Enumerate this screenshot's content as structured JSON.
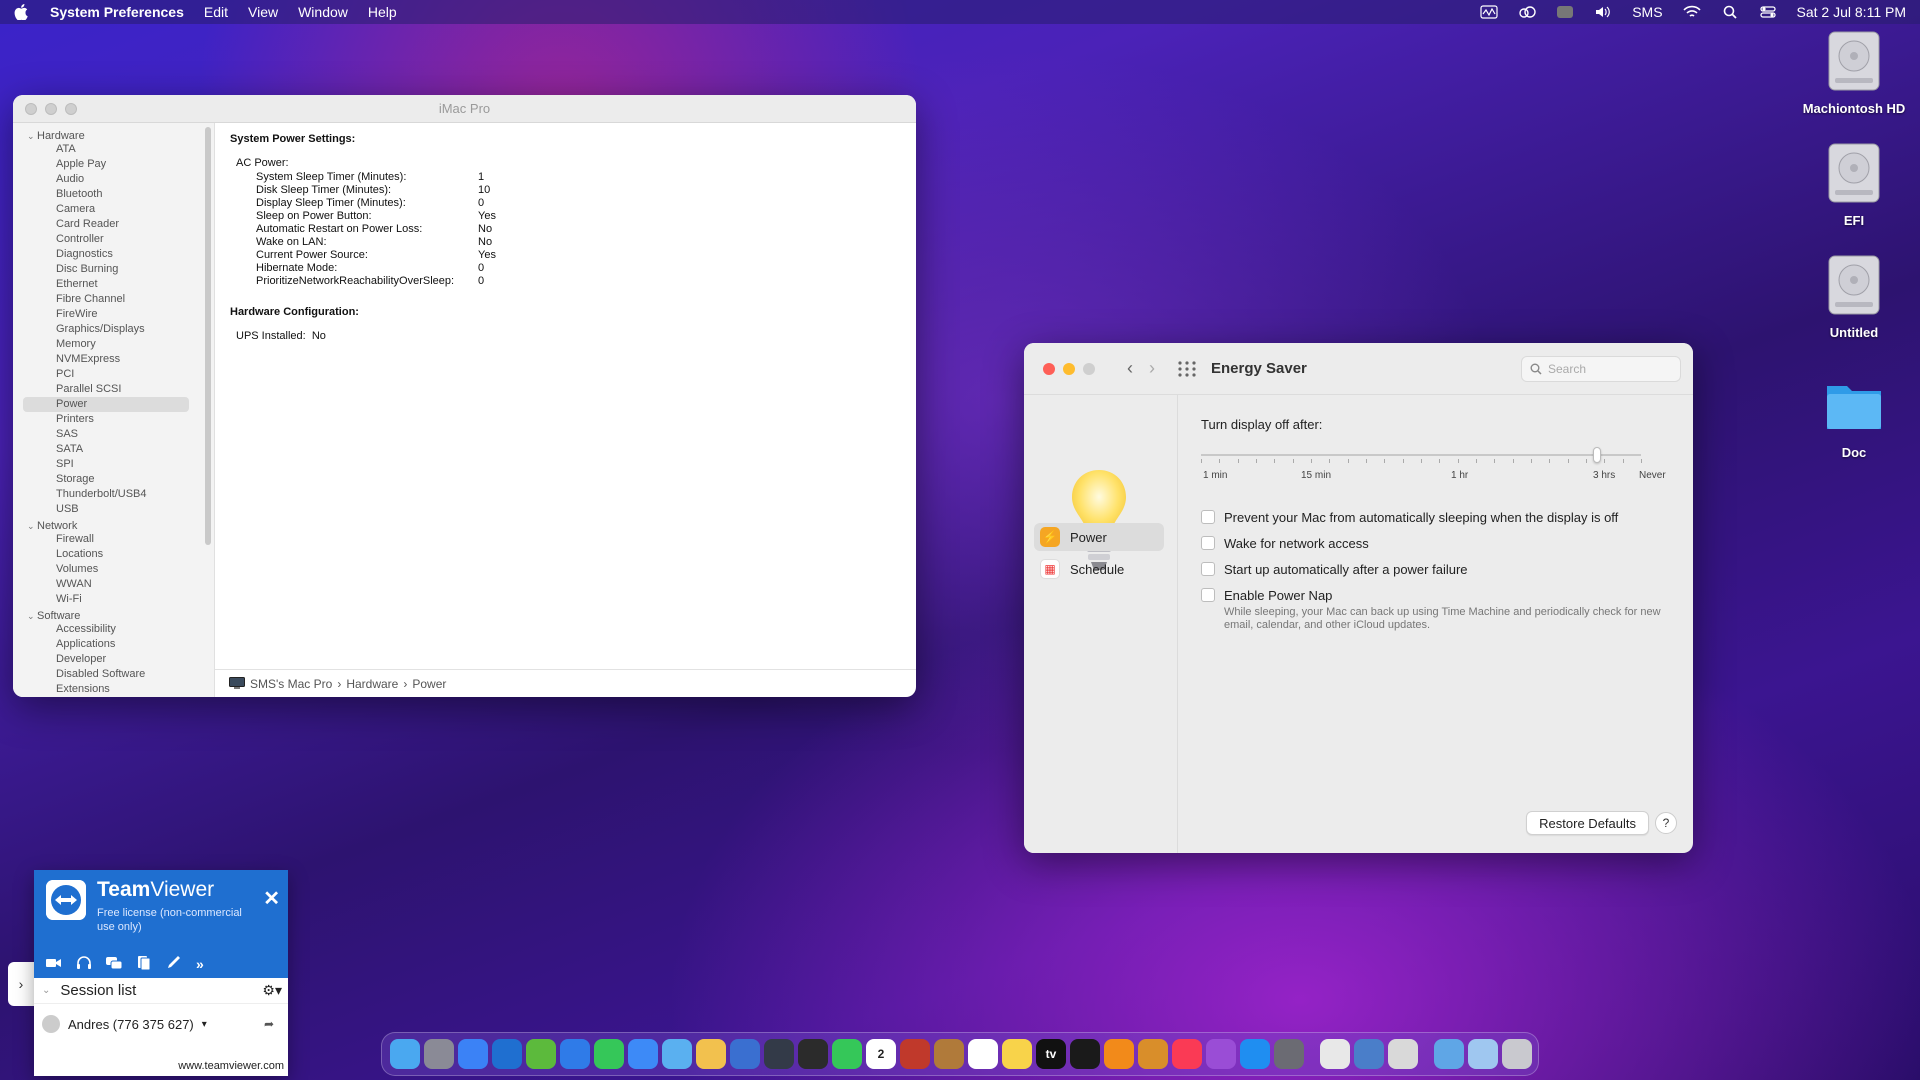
{
  "menubar": {
    "app_name": "System Preferences",
    "menus": [
      "Edit",
      "View",
      "Window",
      "Help"
    ],
    "user": "SMS",
    "datetime": "Sat 2 Jul  8:11 PM"
  },
  "desktop_icons": [
    "Machiontosh HD",
    "EFI",
    "Untitled",
    "Doc"
  ],
  "sysinfo": {
    "title": "iMac Pro",
    "tree": {
      "hardware_label": "Hardware",
      "hardware": [
        "ATA",
        "Apple Pay",
        "Audio",
        "Bluetooth",
        "Camera",
        "Card Reader",
        "Controller",
        "Diagnostics",
        "Disc Burning",
        "Ethernet",
        "Fibre Channel",
        "FireWire",
        "Graphics/Displays",
        "Memory",
        "NVMExpress",
        "PCI",
        "Parallel SCSI",
        "Power",
        "Printers",
        "SAS",
        "SATA",
        "SPI",
        "Storage",
        "Thunderbolt/USB4",
        "USB"
      ],
      "network_label": "Network",
      "network": [
        "Firewall",
        "Locations",
        "Volumes",
        "WWAN",
        "Wi-Fi"
      ],
      "software_label": "Software",
      "software": [
        "Accessibility",
        "Applications",
        "Developer",
        "Disabled Software",
        "Extensions"
      ]
    },
    "selected": "Power",
    "content": {
      "heading": "System Power Settings:",
      "ac_power_label": "AC Power:",
      "settings": [
        {
          "k": "System Sleep Timer (Minutes):",
          "v": "1"
        },
        {
          "k": "Disk Sleep Timer (Minutes):",
          "v": "10"
        },
        {
          "k": "Display Sleep Timer (Minutes):",
          "v": "0"
        },
        {
          "k": "Sleep on Power Button:",
          "v": "Yes"
        },
        {
          "k": "Automatic Restart on Power Loss:",
          "v": "No"
        },
        {
          "k": "Wake on LAN:",
          "v": "No"
        },
        {
          "k": "Current Power Source:",
          "v": "Yes"
        },
        {
          "k": "Hibernate Mode:",
          "v": "0"
        },
        {
          "k": "PrioritizeNetworkReachabilityOverSleep:",
          "v": "0"
        }
      ],
      "hw_heading": "Hardware Configuration:",
      "ups_label": "UPS Installed:",
      "ups_value": "No"
    },
    "path": {
      "computer": "SMS's Mac Pro",
      "sep": "›",
      "section": "Hardware",
      "item": "Power"
    }
  },
  "energy": {
    "title": "Energy Saver",
    "search_placeholder": "Search",
    "tabs": [
      "Power",
      "Schedule"
    ],
    "slider_label": "Turn display off after:",
    "slider_ticks": [
      "1 min",
      "15 min",
      "1 hr",
      "3 hrs",
      "Never"
    ],
    "slider_value_fraction": 0.9,
    "options": [
      "Prevent your Mac from automatically sleeping when the display is off",
      "Wake for network access",
      "Start up automatically after a power failure",
      "Enable Power Nap"
    ],
    "power_nap_note": "While sleeping, your Mac can back up using Time Machine and periodically check for new email, calendar, and other iCloud updates.",
    "restore_label": "Restore Defaults",
    "help_label": "?"
  },
  "teamviewer": {
    "name_bold": "Team",
    "name_light": "Viewer",
    "license": "Free license (non-commercial use only)",
    "session_list": "Session list",
    "contact": "Andres (776 375 627)",
    "url": "www.teamviewer.com"
  },
  "dock": {
    "calendar_day": "2",
    "tv_label": "tv",
    "apps": [
      "finder",
      "launchpad",
      "pages",
      "teamviewer",
      "utorrent",
      "safari",
      "messages",
      "mail",
      "maps",
      "photos",
      "safari-tech",
      "screenshot",
      "final-cut",
      "facetime",
      "calendar",
      "photobooth",
      "books",
      "reminders",
      "notes",
      "apple-tv",
      "infuse",
      "vlc",
      "codeedit",
      "music",
      "podcasts",
      "app-store",
      "system-preferences",
      "textedit",
      "network",
      "printer",
      "downloads",
      "mail-folder",
      "trash"
    ]
  }
}
